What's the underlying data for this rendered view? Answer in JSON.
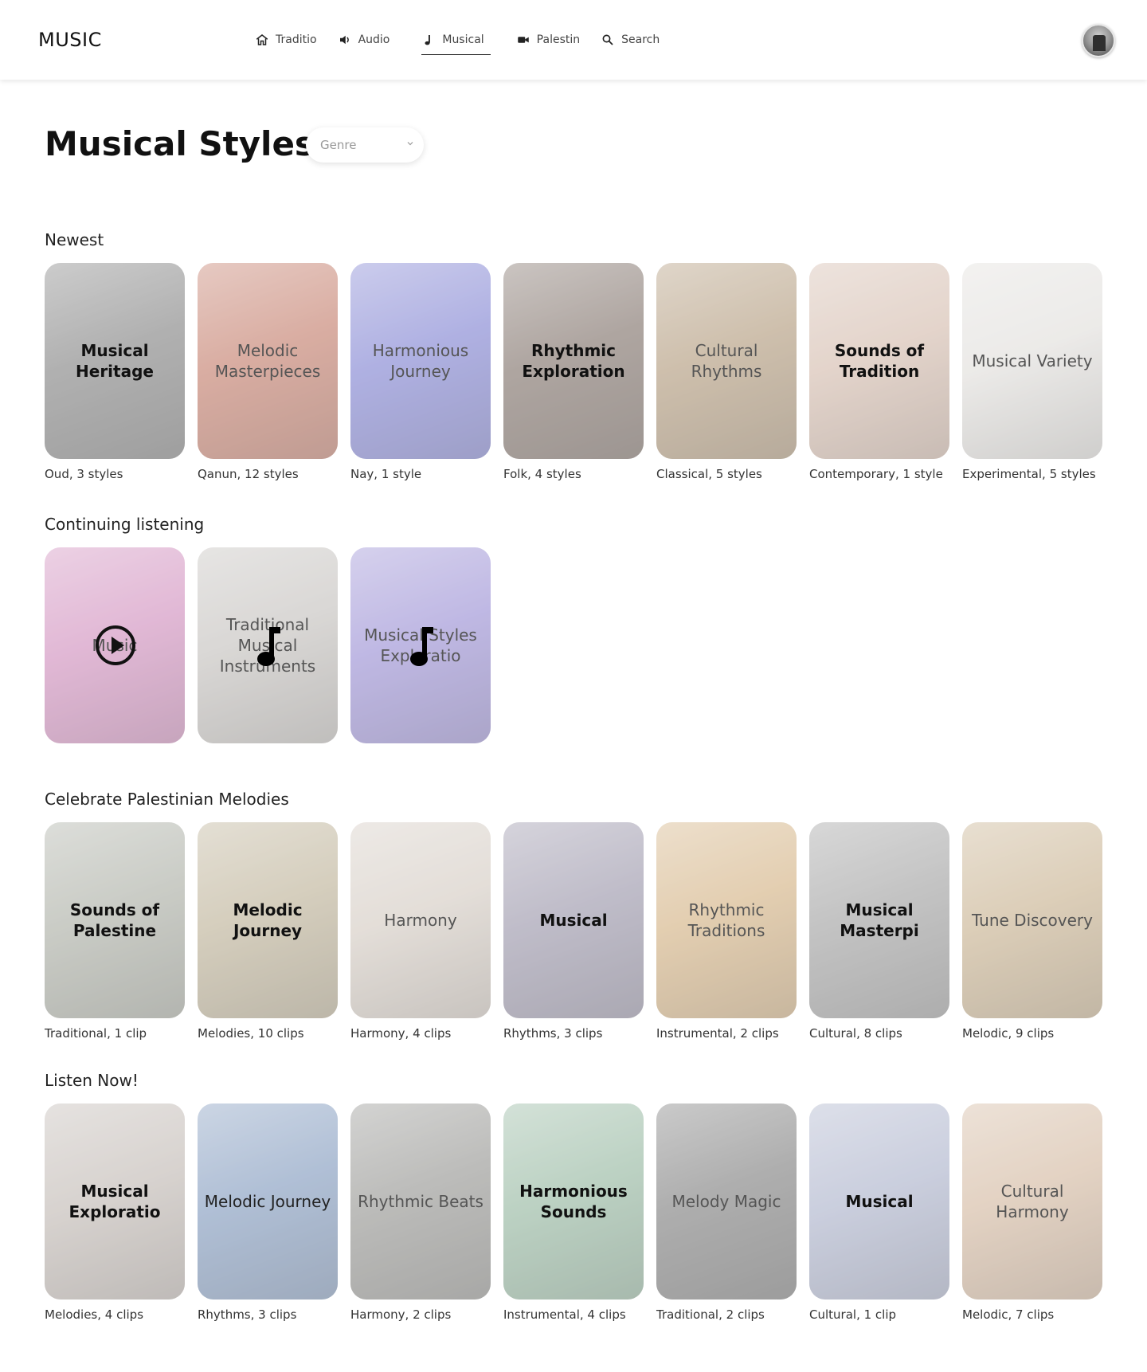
{
  "header": {
    "brand": "MUSIC",
    "nav": [
      {
        "label": "Traditio",
        "icon": "home-icon"
      },
      {
        "label": "Audio",
        "icon": "speaker-icon"
      },
      {
        "label": "Musical",
        "icon": "music-note-icon",
        "active": true
      },
      {
        "label": "Palestin",
        "icon": "video-camera-icon"
      },
      {
        "label": "Search",
        "icon": "search-icon"
      }
    ]
  },
  "page": {
    "title": "Musical Styles",
    "genre_placeholder": "Genre"
  },
  "sections": {
    "newest": {
      "title": "Newest",
      "cards": [
        {
          "label": "Musical Heritage",
          "caption": "Oud, 3 styles",
          "bold": true,
          "bg": "#8f8f8f"
        },
        {
          "label": "Melodic Masterpieces",
          "caption": "Qanun, 12 styles",
          "bold": false,
          "bg": "#c98a7a"
        },
        {
          "label": "Harmonious Journey",
          "caption": "Nay, 1 style",
          "bold": false,
          "bg": "#8d8fd6"
        },
        {
          "label": "Rhythmic Exploration",
          "caption": "Folk, 4 styles",
          "bold": true,
          "bg": "#8c7f78"
        },
        {
          "label": "Cultural Rhythms",
          "caption": "Classical, 5 styles",
          "bold": false,
          "bg": "#b9a489"
        },
        {
          "label": "Sounds of Tradition",
          "caption": "Contemporary, 1 style",
          "bold": true,
          "bg": "#d8c2b5"
        },
        {
          "label": "Musical Variety",
          "caption": "Experimental, 5 styles",
          "bold": false,
          "bg": "#e4e2df"
        }
      ]
    },
    "continuing": {
      "title": "Continuing listening",
      "cards": [
        {
          "label": "Music",
          "bold": false,
          "bg": "#d59ac4",
          "icon": "play-circle-icon"
        },
        {
          "label": "Traditional Musical Instruments",
          "bold": false,
          "bg": "#c9c6c3",
          "icon": "music-note-icon"
        },
        {
          "label": "Musical Styles Exploratio",
          "bold": false,
          "bg": "#a49ad8",
          "icon": "music-note-icon"
        }
      ]
    },
    "palestinian": {
      "title": "Celebrate Palestinian Melodies",
      "cards": [
        {
          "label": "Sounds of Palestine",
          "caption": "Traditional, 1 clip",
          "bold": true,
          "bg": "#b3b6ad"
        },
        {
          "label": "Melodic Journey",
          "caption": "Melodies, 10 clips",
          "bold": true,
          "bg": "#c3b9a1"
        },
        {
          "label": "Harmony",
          "caption": "Harmony, 4 clips",
          "bold": false,
          "bg": "#d8d0c8"
        },
        {
          "label": "Musical",
          "caption": "Rhythms, 3 clips",
          "bold": true,
          "bg": "#a4a0b2"
        },
        {
          "label": "Rhythmic Traditions",
          "caption": "Instrumental, 2 clips",
          "bold": false,
          "bg": "#d7b98f"
        },
        {
          "label": "Musical Masterpi",
          "caption": "Cultural, 8 clips",
          "bold": true,
          "bg": "#a9a9a9"
        },
        {
          "label": "Tune Discovery",
          "caption": "Melodic, 9 clips",
          "bold": false,
          "bg": "#cdb99a"
        }
      ]
    },
    "listen_now": {
      "title": "Listen Now!",
      "cards": [
        {
          "label": "Musical Exploratio",
          "caption": "Melodies, 4 clips",
          "bold": true,
          "bg": "#c7c0bb"
        },
        {
          "label": "Melodic Journey",
          "caption": "Rhythms, 3 clips",
          "bold": false,
          "bg": "#8ea4c4"
        },
        {
          "label": "Rhythmic Beats",
          "caption": "Harmony, 2 clips",
          "bold": false,
          "bg": "#9f9f9c"
        },
        {
          "label": "Harmonious Sounds",
          "caption": "Instrumental, 4 clips",
          "bold": true,
          "bg": "#9fbea9"
        },
        {
          "label": "Melody Magic",
          "caption": "Traditional, 2 clips",
          "bold": false,
          "bg": "#8b8b8b"
        },
        {
          "label": "Musical",
          "caption": "Cultural, 1 clip",
          "bold": true,
          "bg": "#b4bad0"
        },
        {
          "label": "Cultural Harmony",
          "caption": "Melodic, 7 clips",
          "bold": false,
          "bg": "#d7bfa9"
        }
      ]
    }
  },
  "colors": {
    "text": "#111111",
    "muted": "#555555",
    "card_overlay": "rgba(255,255,255,0.30)"
  }
}
